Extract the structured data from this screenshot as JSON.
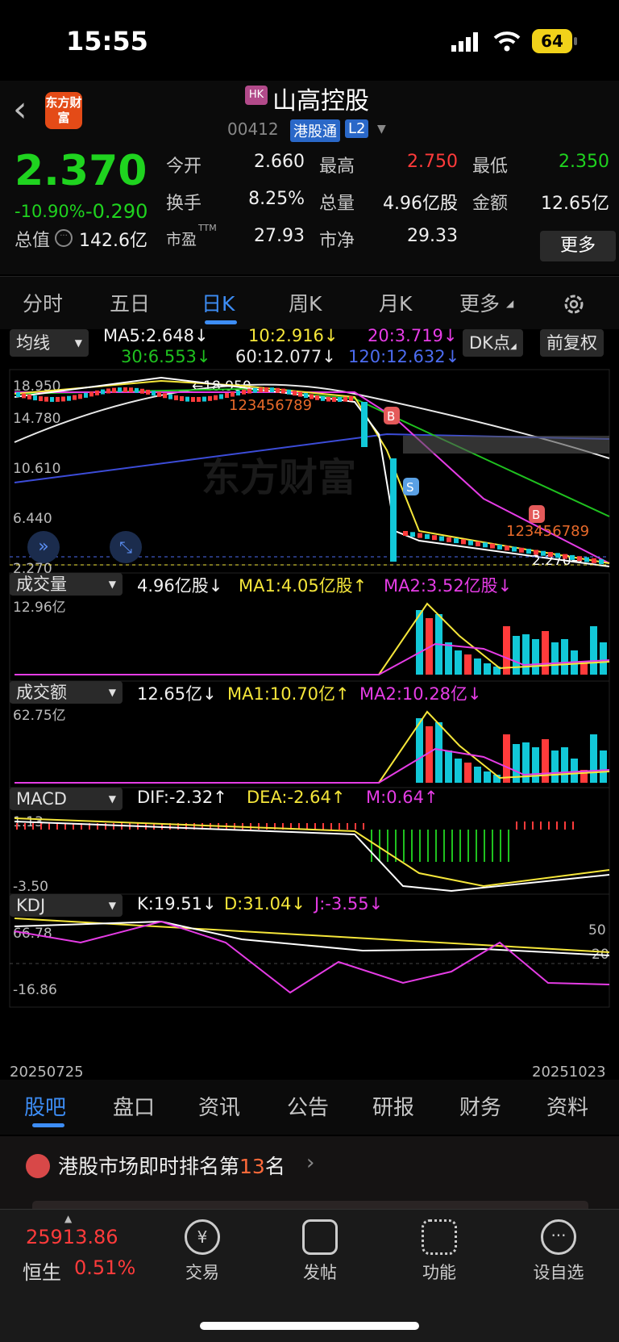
{
  "status": {
    "time": "15:55",
    "battery": "64"
  },
  "header": {
    "logo": "东方财富",
    "badge": "HK",
    "title": "山高控股",
    "code": "00412",
    "tag1": "港股通",
    "tag2": "L2"
  },
  "quote": {
    "price": "2.370",
    "pct": "-10.90%",
    "chg": "-0.290",
    "open_label": "今开",
    "open": "2.660",
    "high_label": "最高",
    "high": "2.750",
    "low_label": "最低",
    "low": "2.350",
    "turnover_label": "换手",
    "turnover": "8.25%",
    "vol_label": "总量",
    "vol": "4.96亿股",
    "amt_label": "金额",
    "amt": "12.65亿",
    "mcap_label": "总值",
    "mcap": "142.6亿",
    "pe_label": "市盈",
    "pe_sup": "TTM",
    "pe": "27.93",
    "pb_label": "市净",
    "pb": "29.33",
    "more": "更多"
  },
  "tabs": [
    "分时",
    "五日",
    "日K",
    "周K",
    "月K",
    "更多"
  ],
  "indicators": {
    "ma_btn": "均线",
    "ma5": "MA5:2.648↓",
    "ma10": "10:2.916↓",
    "ma20": "20:3.719↓",
    "ma30": "30:6.553↓",
    "ma60": "60:12.077↓",
    "ma120": "120:12.632↓",
    "dk_btn": "DK点",
    "fq_btn": "前复权",
    "vol_btn": "成交量",
    "vol_v": "4.96亿股↓",
    "vol_ma1": "MA1:4.05亿股↑",
    "vol_ma2": "MA2:3.52亿股↓",
    "amt_btn": "成交额",
    "amt_v": "12.65亿↓",
    "amt_ma1": "MA1:10.70亿↑",
    "amt_ma2": "MA2:10.28亿↓",
    "macd_btn": "MACD",
    "dif": "DIF:-2.32↑",
    "dea": "DEA:-2.64↑",
    "m": "M:0.64↑",
    "kdj_btn": "KDJ",
    "k": "K:19.51↓",
    "d": "D:31.04↓",
    "j": "J:-3.55↓"
  },
  "axis": {
    "p1": "18.950",
    "p2": "14.780",
    "p3": "10.610",
    "p4": "6.440",
    "p5": "2.270",
    "hi_mark": "18.950",
    "lo_mark": "2.270",
    "vol_max": "12.96亿",
    "amt_max": "62.75亿",
    "macd_max": "1.13",
    "macd_min": "-3.50",
    "kdj_max": "66.78",
    "kdj_min": "-16.86",
    "kdj_50": "50",
    "kdj_20": "20",
    "date_start": "20250725",
    "date_end": "20251023"
  },
  "watermark": "东方财富",
  "bottom_tabs": [
    "股吧",
    "盘口",
    "资讯",
    "公告",
    "研报",
    "财务",
    "资料"
  ],
  "banner": {
    "text_pre": "港股市场即时排名第",
    "rank": "13",
    "text_post": "名"
  },
  "nav": {
    "index_value": "25913.86",
    "index_name": "恒生",
    "index_pct": "0.51%",
    "items": [
      "交易",
      "发帖",
      "功能",
      "设自选"
    ]
  }
}
